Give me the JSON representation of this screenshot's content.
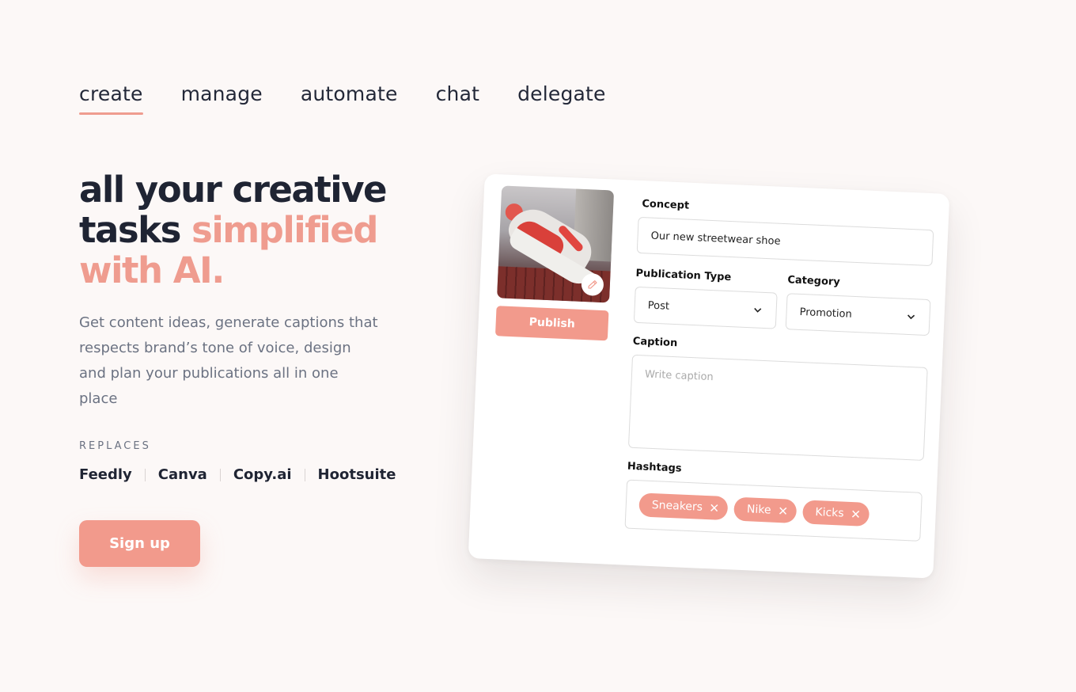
{
  "nav": {
    "tabs": [
      {
        "label": "create",
        "active": true
      },
      {
        "label": "manage",
        "active": false
      },
      {
        "label": "automate",
        "active": false
      },
      {
        "label": "chat",
        "active": false
      },
      {
        "label": "delegate",
        "active": false
      }
    ]
  },
  "hero": {
    "headline_part1": "all your creative tasks",
    "headline_accent": "simplified with AI.",
    "subtitle": "Get content ideas, generate captions that respects brand’s tone of voice, design and plan your publications all in one place",
    "replaces_label": "REPLACES",
    "replaces": [
      "Feedly",
      "Canva",
      "Copy.ai",
      "Hootsuite"
    ],
    "signup_label": "Sign up"
  },
  "card": {
    "image_icon": "pencil-icon",
    "publish_label": "Publish",
    "concept": {
      "label": "Concept",
      "value": "Our new streetwear shoe"
    },
    "publication_type": {
      "label": "Publication Type",
      "value": "Post"
    },
    "category": {
      "label": "Category",
      "value": "Promotion"
    },
    "caption": {
      "label": "Caption",
      "placeholder": "Write caption"
    },
    "hashtags": {
      "label": "Hashtags",
      "items": [
        "Sneakers",
        "Nike",
        "Kicks"
      ]
    }
  },
  "colors": {
    "accent": "#f29a8c",
    "headline": "#1f2433",
    "muted": "#6b7282",
    "background": "#fcf8f7"
  }
}
